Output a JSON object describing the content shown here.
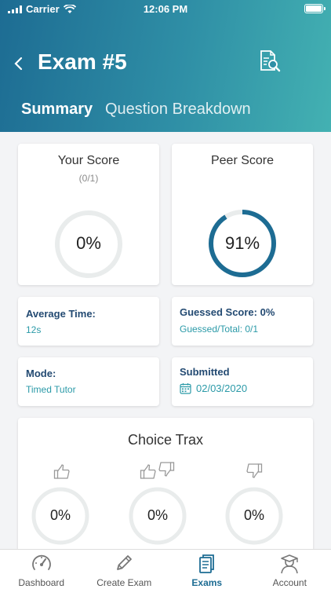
{
  "status_bar": {
    "carrier": "Carrier",
    "time": "12:06 PM"
  },
  "header": {
    "title": "Exam #5"
  },
  "segments": [
    {
      "label": "Summary",
      "active": true
    },
    {
      "label": "Question Breakdown",
      "active": false
    }
  ],
  "your_score": {
    "title": "Your Score",
    "subtitle": "(0/1)",
    "percent_label": "0%",
    "percent": 0
  },
  "peer_score": {
    "title": "Peer Score",
    "percent_label": "91%",
    "percent": 91
  },
  "average_time": {
    "label": "Average Time:",
    "value": "12s"
  },
  "guessed": {
    "label": "Guessed Score: 0%",
    "value": "Guessed/Total: 0/1"
  },
  "mode": {
    "label": "Mode:",
    "value": "Timed Tutor"
  },
  "submitted": {
    "label": "Submitted",
    "value": "02/03/2020"
  },
  "choice_trax": {
    "title": "Choice Trax",
    "items": [
      {
        "icon": "thumbs-up-icon",
        "percent_label": "0%",
        "percent": 0
      },
      {
        "icon": "thumbs-up-down-icon",
        "percent_label": "0%",
        "percent": 0
      },
      {
        "icon": "thumbs-down-icon",
        "percent_label": "0%",
        "percent": 0
      }
    ]
  },
  "tabs": [
    {
      "label": "Dashboard",
      "icon": "speedometer-icon",
      "active": false
    },
    {
      "label": "Create Exam",
      "icon": "pencil-icon",
      "active": false
    },
    {
      "label": "Exams",
      "icon": "exams-document-icon",
      "active": true
    },
    {
      "label": "Account",
      "icon": "graduate-user-icon",
      "active": false
    }
  ],
  "colors": {
    "header_start": "#1d6c93",
    "header_end": "#43b1b2",
    "accent": "#1d6c93",
    "ring_track": "#e9ecec",
    "value_teal": "#2b9aa8",
    "label_navy": "#234a72"
  }
}
